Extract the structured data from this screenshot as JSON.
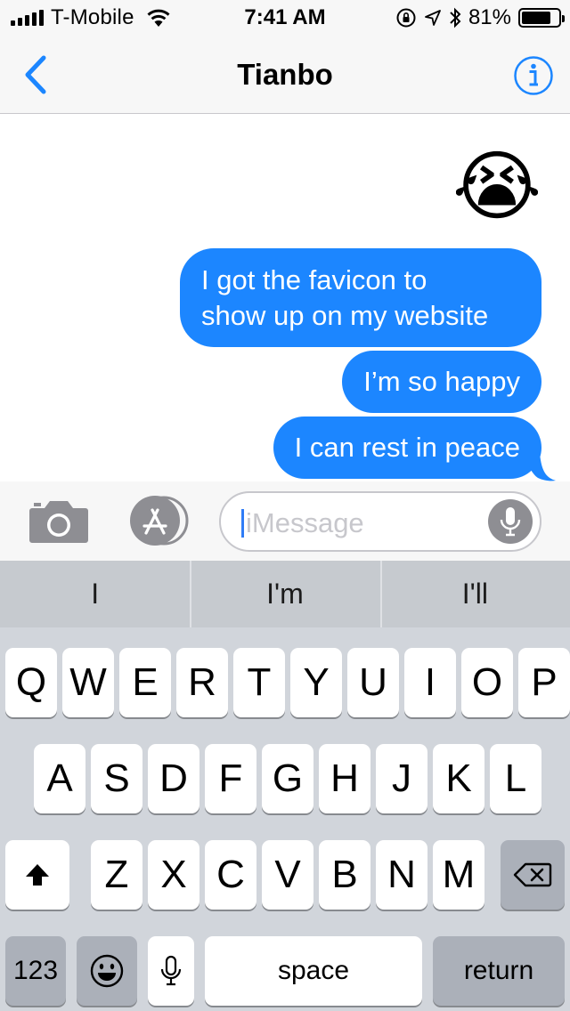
{
  "status_bar": {
    "carrier": "T-Mobile",
    "time": "7:41 AM",
    "battery_percent_label": "81%",
    "battery_level": 0.81,
    "icons": [
      "signal-bars-icon",
      "wifi-icon",
      "orientation-lock-icon",
      "location-arrow-icon",
      "bluetooth-icon",
      "battery-icon"
    ]
  },
  "nav": {
    "title": "Tianbo",
    "back_icon": "chevron-left-icon",
    "info_icon": "info-icon"
  },
  "conversation": {
    "emoji_message": "😭",
    "messages": [
      {
        "text_lines": [
          "I got the favicon to",
          "show up on my website"
        ]
      },
      {
        "text_lines": [
          "I’m so happy"
        ]
      },
      {
        "text_lines": [
          "I can rest in peace"
        ]
      }
    ]
  },
  "input_bar": {
    "camera_icon": "camera-icon",
    "apps_icon": "app-store-icon",
    "placeholder": "iMessage",
    "mic_icon": "microphone-icon"
  },
  "keyboard": {
    "predictions": [
      "I",
      "I'm",
      "I'll"
    ],
    "row1": [
      "Q",
      "W",
      "E",
      "R",
      "T",
      "Y",
      "U",
      "I",
      "O",
      "P"
    ],
    "row2": [
      "A",
      "S",
      "D",
      "F",
      "G",
      "H",
      "J",
      "K",
      "L"
    ],
    "row3": [
      "Z",
      "X",
      "C",
      "V",
      "B",
      "N",
      "M"
    ],
    "numbers_label": "123",
    "space_label": "space",
    "return_label": "return",
    "shift_icon": "shift-arrow-icon",
    "delete_icon": "backspace-icon",
    "emoji_icon": "emoji-face-icon",
    "dictation_icon": "microphone-icon"
  },
  "colors": {
    "accent": "#1c86ff",
    "bubble_text": "#ffffff",
    "keyboard_bg": "#d1d5db",
    "dark_key": "#abb0b9"
  }
}
